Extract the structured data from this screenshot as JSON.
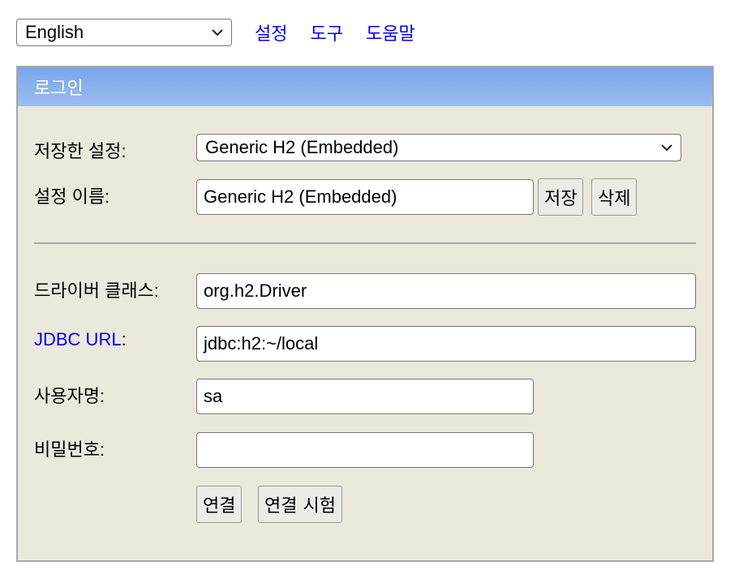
{
  "top": {
    "language_selected": "English",
    "links": [
      "설정",
      "도구",
      "도움말"
    ]
  },
  "panel": {
    "title": "로그인",
    "saved_settings_label": "저장한 설정:",
    "saved_settings_value": "Generic H2 (Embedded)",
    "setting_name_label": "설정 이름:",
    "setting_name_value": "Generic H2 (Embedded)",
    "save_button": "저장",
    "delete_button": "삭제",
    "driver_class_label": "드라이버 클래스:",
    "driver_class_value": "org.h2.Driver",
    "jdbc_url_label_link": "JDBC URL",
    "jdbc_url_label_colon": ":",
    "jdbc_url_value": "jdbc:h2:~/local",
    "username_label": "사용자명:",
    "username_value": "sa",
    "password_label": "비밀번호:",
    "password_value": "",
    "connect_button": "연결",
    "test_connection_button": "연결 시험"
  },
  "colors": {
    "header_gradient_top": "#78a6e8",
    "header_gradient_bottom": "#9bbdf0",
    "panel_background": "#ebe9dc",
    "link": "#0000ee"
  }
}
